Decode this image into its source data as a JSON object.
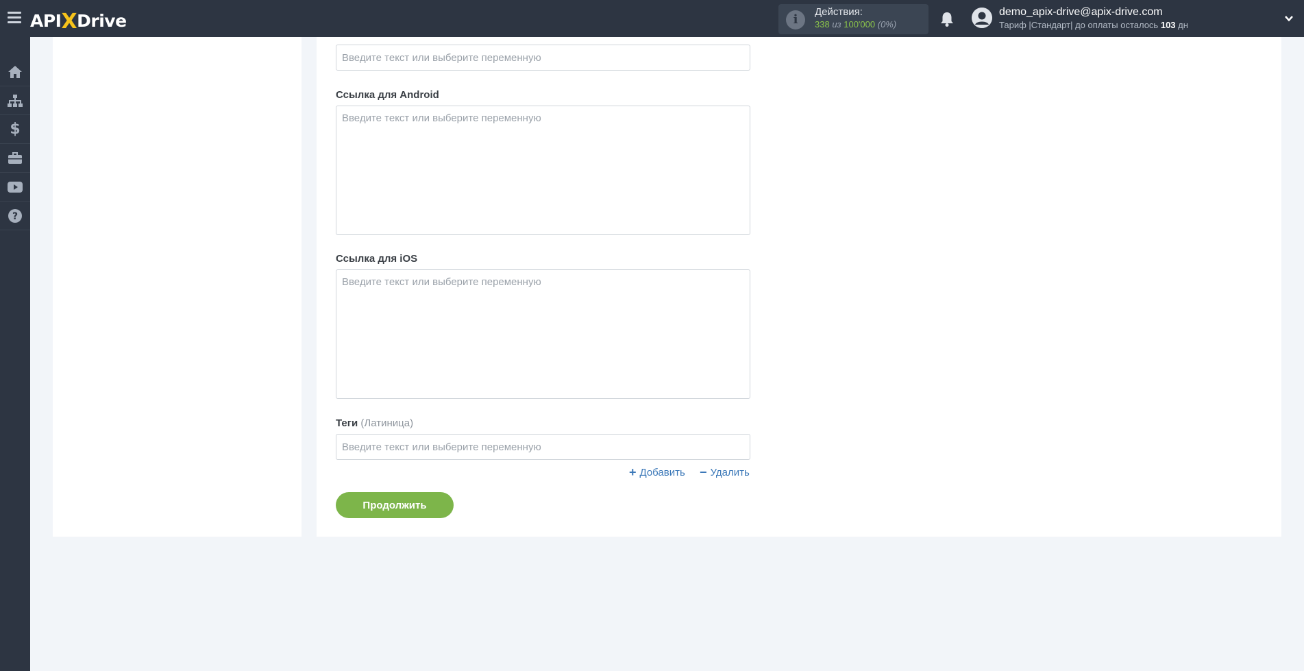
{
  "header": {
    "logo": {
      "part1": "API",
      "x": "X",
      "part2": "Drive"
    },
    "actions": {
      "title": "Действия:",
      "used": "338",
      "of": "из",
      "limit": "100'000",
      "percent": "(0%)"
    },
    "user": {
      "email": "demo_apix-drive@apix-drive.com",
      "plan_prefix": "Тариф |Стандарт| до оплаты осталось",
      "days": "103",
      "days_suffix": "дн"
    }
  },
  "sidebar": {
    "items": [
      {
        "icon": "home-icon"
      },
      {
        "icon": "sitemap-icon"
      },
      {
        "icon": "dollar-icon"
      },
      {
        "icon": "briefcase-icon"
      },
      {
        "icon": "youtube-icon"
      },
      {
        "icon": "help-icon"
      }
    ]
  },
  "form": {
    "top_field": {
      "placeholder": "Введите текст или выберите переменную"
    },
    "android_link": {
      "label": "Ссылка для Android",
      "placeholder": "Введите текст или выберите переменную"
    },
    "ios_link": {
      "label": "Ссылка для iOS",
      "placeholder": "Введите текст или выберите переменную"
    },
    "tags": {
      "label": "Теги",
      "hint": "(Латиница)",
      "placeholder": "Введите текст или выберите переменную"
    },
    "add_label": "Добавить",
    "remove_label": "Удалить",
    "continue_label": "Продолжить"
  },
  "colors": {
    "topbar": "#2d3542",
    "accent_green": "#7db54a",
    "link_blue": "#3b78b8",
    "logo_x": "#f7c31a"
  }
}
